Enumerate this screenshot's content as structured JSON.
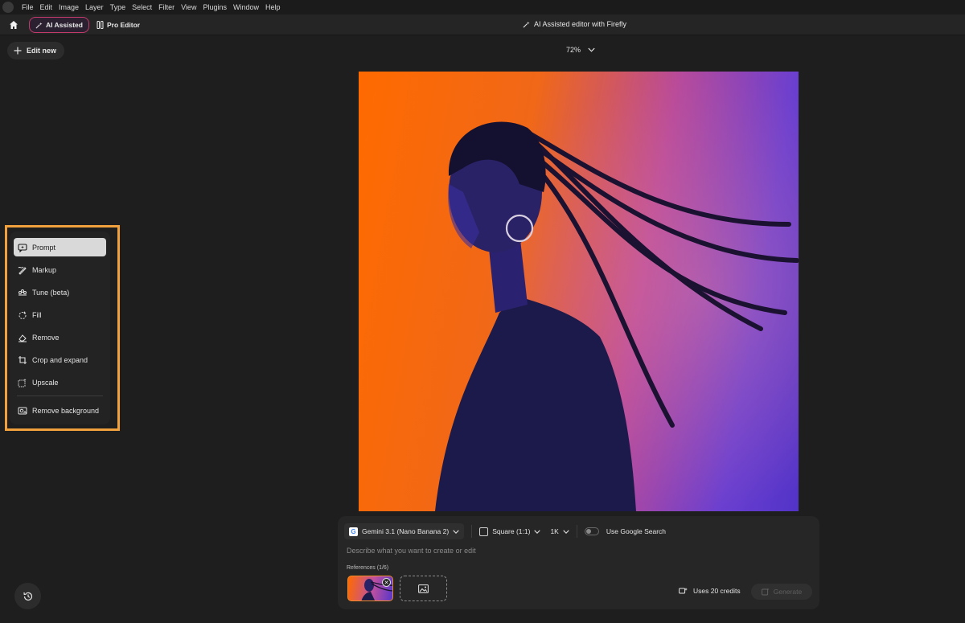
{
  "menubar": {
    "items": [
      "File",
      "Edit",
      "Image",
      "Layer",
      "Type",
      "Select",
      "Filter",
      "View",
      "Plugins",
      "Window",
      "Help"
    ]
  },
  "topbar": {
    "modes": [
      "AI Assisted",
      "Pro Editor"
    ],
    "active_mode": "AI Assisted",
    "title": "AI Assisted editor with Firefly"
  },
  "edit_new_label": "Edit new",
  "zoom": {
    "value": "72%"
  },
  "toolbar": {
    "items": [
      {
        "label": "Prompt",
        "icon": "prompt-icon",
        "active": true
      },
      {
        "label": "Markup",
        "icon": "markup-icon"
      },
      {
        "label": "Tune (beta)",
        "icon": "tune-icon"
      },
      {
        "label": "Fill",
        "icon": "fill-icon"
      },
      {
        "label": "Remove",
        "icon": "remove-icon"
      },
      {
        "label": "Crop and expand",
        "icon": "crop-icon"
      },
      {
        "label": "Upscale",
        "icon": "upscale-icon"
      },
      {
        "label": "Remove background",
        "icon": "remove-background-icon"
      }
    ]
  },
  "prompt_panel": {
    "model": "Gemini 3.1 (Nano Banana 2)",
    "aspect": "Square (1:1)",
    "resolution": "1K",
    "google_search_label": "Use Google Search",
    "google_search_enabled": false,
    "placeholder": "Describe what you want to create or edit",
    "references_label": "References (1/6)",
    "credits": "Uses 20 credits",
    "generate_label": "Generate"
  },
  "colors": {
    "accent_orange": "#f0a03c",
    "active_mode_border": "#c33a6b",
    "background": "#1e1e1e"
  }
}
